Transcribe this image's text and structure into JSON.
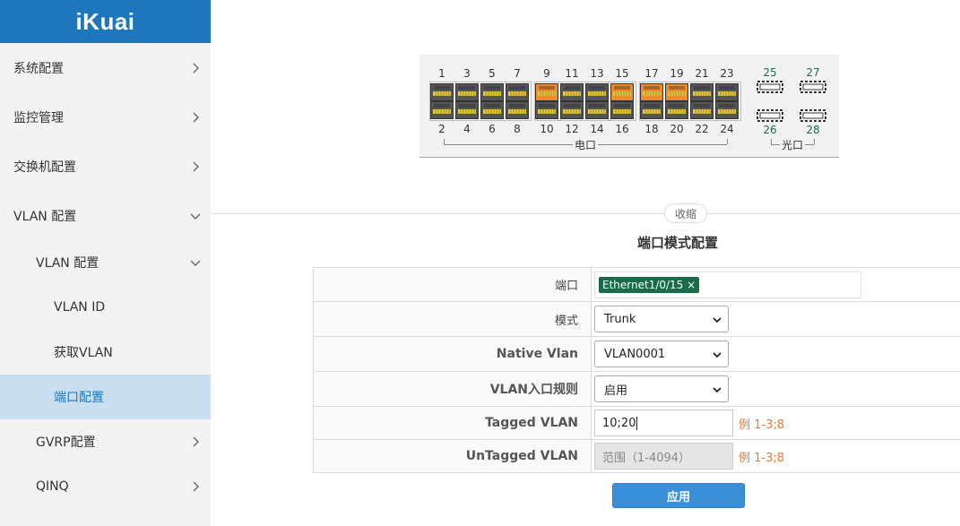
{
  "logo": "iKuai",
  "sidebar": {
    "items": [
      {
        "label": "系统配置",
        "level": 0,
        "chevron": "right"
      },
      {
        "label": "监控管理",
        "level": 0,
        "chevron": "right"
      },
      {
        "label": "交换机配置",
        "level": 0,
        "chevron": "right"
      },
      {
        "label": "VLAN 配置",
        "level": 0,
        "chevron": "down"
      },
      {
        "label": "VLAN 配置",
        "level": 1,
        "chevron": "down"
      },
      {
        "label": "VLAN ID",
        "level": 2,
        "chevron": ""
      },
      {
        "label": "获取VLAN",
        "level": 2,
        "chevron": ""
      },
      {
        "label": "端口配置",
        "level": 2,
        "chevron": "",
        "active": true
      },
      {
        "label": "GVRP配置",
        "level": 1,
        "chevron": "right"
      },
      {
        "label": "QINQ",
        "level": 1,
        "chevron": "right"
      }
    ]
  },
  "panel": {
    "electric_label": "电口",
    "optical_label": "光口",
    "top_ports": [
      "1",
      "3",
      "5",
      "7",
      "9",
      "11",
      "13",
      "15",
      "17",
      "19",
      "21",
      "23"
    ],
    "bottom_ports": [
      "2",
      "4",
      "6",
      "8",
      "10",
      "12",
      "14",
      "16",
      "18",
      "20",
      "22",
      "24"
    ],
    "optical_top": [
      "25",
      "27"
    ],
    "optical_bottom": [
      "26",
      "28"
    ],
    "active_top": [
      "9",
      "15",
      "17",
      "19"
    ],
    "active_color": "#f08a2c",
    "idle_color": "#555555",
    "optical_color": "#1a6b4a"
  },
  "collapse_label": "收缩",
  "form": {
    "title": "端口模式配置",
    "port_label": "端口",
    "port_tag": "Ethernet1/0/15 ×",
    "mode_label": "模式",
    "mode_value": "Trunk",
    "native_label": "Native Vlan",
    "native_value": "VLAN0001",
    "ingress_label": "VLAN入口规则",
    "ingress_value": "启用",
    "tagged_label": "Tagged VLAN",
    "tagged_value": "10;20",
    "tagged_hint": "例 1-3;8",
    "untagged_label": "UnTagged VLAN",
    "untagged_placeholder": "范围（1-4094）",
    "untagged_hint": "例 1-3;8",
    "apply_label": "应用"
  }
}
